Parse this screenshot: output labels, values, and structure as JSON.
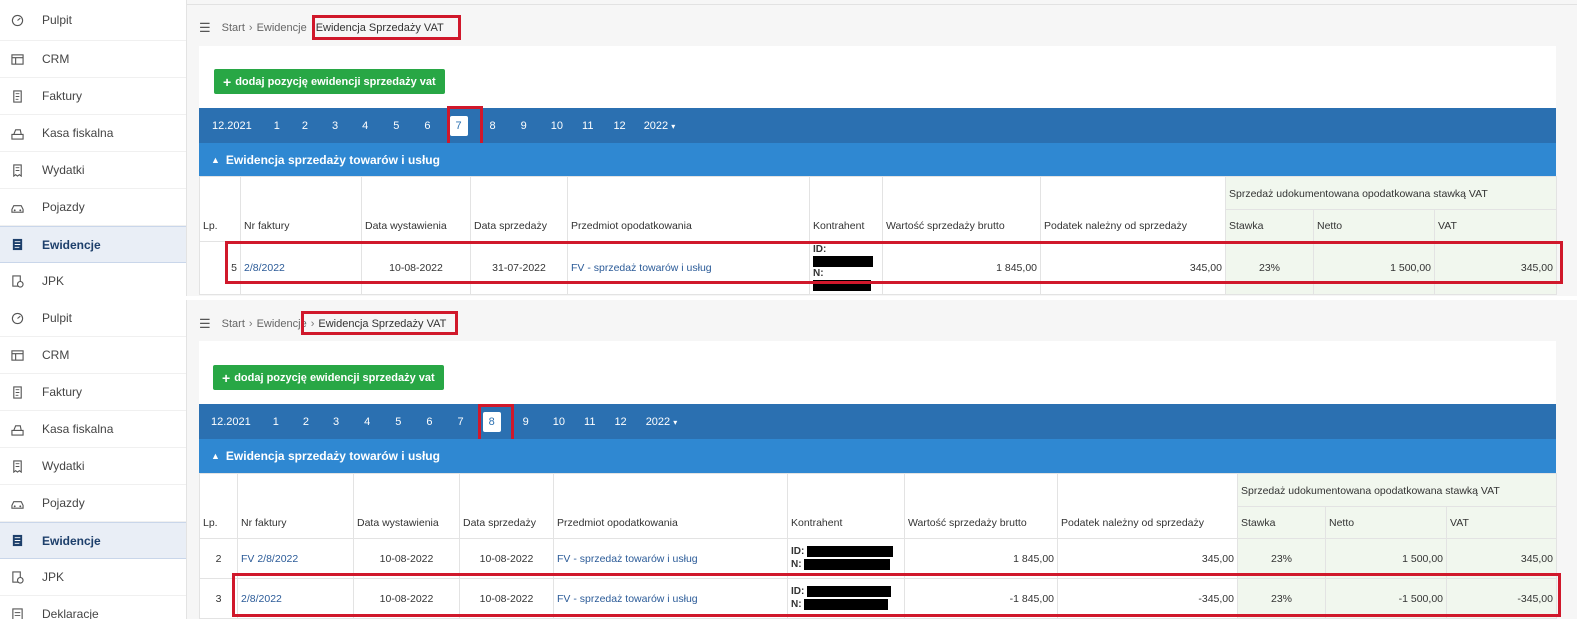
{
  "sidebar": {
    "items": [
      {
        "label": "Pulpit",
        "icon": "dashboard-icon"
      },
      {
        "label": "CRM",
        "icon": "table-icon"
      },
      {
        "label": "Faktury",
        "icon": "invoice-icon"
      },
      {
        "label": "Kasa fiskalna",
        "icon": "cash-register-icon"
      },
      {
        "label": "Wydatki",
        "icon": "receipt-icon"
      },
      {
        "label": "Pojazdy",
        "icon": "car-icon"
      },
      {
        "label": "Ewidencje",
        "icon": "document-icon"
      },
      {
        "label": "JPK",
        "icon": "jpk-icon"
      },
      {
        "label": "Deklaracje",
        "icon": "declaration-icon"
      }
    ],
    "active": "Ewidencje"
  },
  "breadcrumb": {
    "start": "Start",
    "middle": "Ewidencje",
    "current": "Ewidencja Sprzedaży VAT"
  },
  "add_button": "dodaj pozycję ewidencji sprzedaży vat",
  "months": {
    "prev": "12.2021",
    "items": [
      "1",
      "2",
      "3",
      "4",
      "5",
      "6",
      "7",
      "8",
      "9",
      "10",
      "11",
      "12"
    ],
    "year": "2022"
  },
  "section_title": "Ewidencja sprzedaży towarów i usług",
  "table": {
    "group_header": "Sprzedaż udokumentowana opodatkowana stawką VAT",
    "columns": [
      "Lp.",
      "Nr faktury",
      "Data wystawienia",
      "Data sprzedaży",
      "Przedmiot opodatkowania",
      "Kontrahent",
      "Wartość sprzedaży brutto",
      "Podatek należny od sprzedaży",
      "Stawka",
      "Netto",
      "VAT"
    ],
    "id_label": "ID:",
    "n_label": "N:"
  },
  "view1": {
    "selected_month": "7",
    "rows": [
      {
        "lp": "5",
        "nr": "2/8/2022",
        "data_wyst": "10-08-2022",
        "data_sprz": "31-07-2022",
        "przedmiot": "FV - sprzedaż towarów i usług",
        "brutto": "1 845,00",
        "podatek": "345,00",
        "stawka": "23%",
        "netto": "1 500,00",
        "vat": "345,00"
      }
    ]
  },
  "view2": {
    "selected_month": "8",
    "rows": [
      {
        "lp": "2",
        "nr": "FV 2/8/2022",
        "data_wyst": "10-08-2022",
        "data_sprz": "10-08-2022",
        "przedmiot": "FV - sprzedaż towarów i usług",
        "brutto": "1 845,00",
        "podatek": "345,00",
        "stawka": "23%",
        "netto": "1 500,00",
        "vat": "345,00"
      },
      {
        "lp": "3",
        "nr": "2/8/2022",
        "data_wyst": "10-08-2022",
        "data_sprz": "10-08-2022",
        "przedmiot": "FV - sprzedaż towarów i usług",
        "brutto": "-1 845,00",
        "podatek": "-345,00",
        "stawka": "23%",
        "netto": "-1 500,00",
        "vat": "-345,00"
      }
    ]
  },
  "colors": {
    "accent_bar": "#2b70b1",
    "section_bar": "#2f88d2",
    "add_button": "#28a745",
    "highlight": "#d0182b"
  }
}
